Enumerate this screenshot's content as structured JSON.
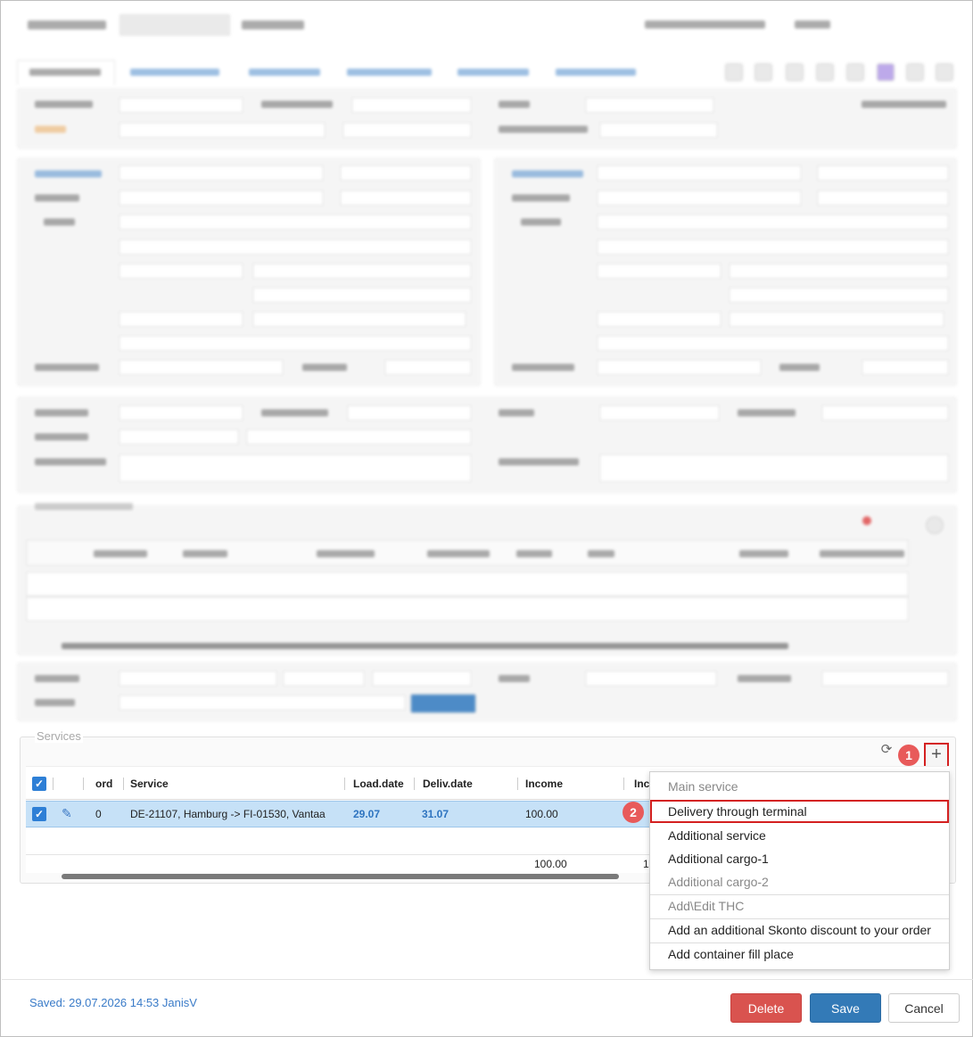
{
  "services": {
    "legend": "Services",
    "grid": {
      "columns": [
        "ord",
        "Service",
        "Load.date",
        "Deliv.date",
        "Income",
        "Inc"
      ],
      "rows": [
        {
          "ord": "0",
          "service": "DE-21107, Hamburg -> FI-01530, Vantaa",
          "load_date": "29.07",
          "deliv_date": "31.07",
          "income": "100.00"
        }
      ],
      "totals": {
        "income": "100.00",
        "next": "1"
      }
    },
    "markers": {
      "one": "1",
      "two": "2"
    },
    "add_label": "+",
    "refresh_label": "⟳"
  },
  "menu": {
    "items": [
      {
        "label": "Main service",
        "disabled": true
      },
      {
        "label": "Delivery through terminal",
        "highlight": true
      },
      {
        "label": "Additional service"
      },
      {
        "label": "Additional cargo-1"
      },
      {
        "label": "Additional cargo-2",
        "disabled": true
      },
      {
        "label": "Add\\Edit THC",
        "disabled": true
      },
      {
        "label": "Add an additional Skonto discount to your order"
      },
      {
        "label": "Add container fill place"
      }
    ]
  },
  "footer": {
    "saved": "Saved: 29.07.2026 14:53 JanisV",
    "delete_label": "Delete",
    "save_label": "Save",
    "cancel_label": "Cancel"
  },
  "colors": {
    "accent": "#337ab7",
    "danger": "#d9534f",
    "highlight_border": "#d42020",
    "selected_row": "#c6e1f7"
  }
}
